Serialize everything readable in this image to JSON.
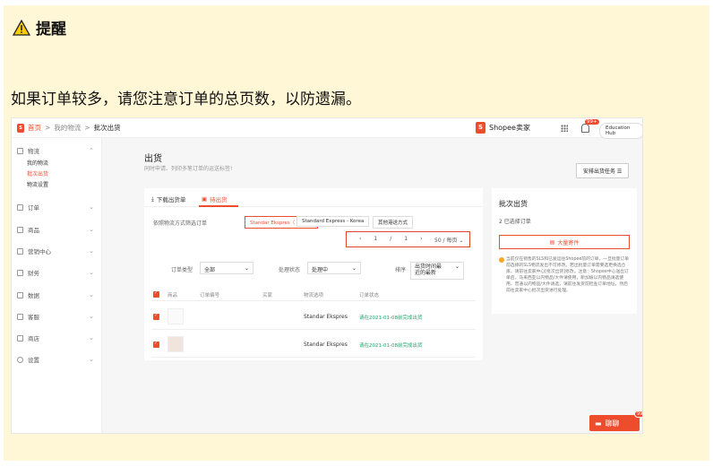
{
  "callout": {
    "title": "提醒",
    "body": "如果订单较多，请您注意订单的总页数，以防遗漏。"
  },
  "breadcrumb": {
    "home": "首页",
    "sep": ">",
    "l2": "我的物流",
    "current": "批次出货"
  },
  "topbar": {
    "brand": "Shopee卖家",
    "brand_icon": "shopee-bag-icon",
    "badge": "99+",
    "edu": "Education Hub"
  },
  "sidebar": {
    "items": [
      {
        "label": "物流",
        "icon": "truck-icon"
      },
      {
        "label": "订单",
        "icon": "clipboard-icon"
      },
      {
        "label": "商品",
        "icon": "box-icon"
      },
      {
        "label": "营销中心",
        "icon": "tag-icon"
      },
      {
        "label": "财务",
        "icon": "wallet-icon"
      },
      {
        "label": "数据",
        "icon": "chart-icon"
      },
      {
        "label": "客服",
        "icon": "chat-icon"
      },
      {
        "label": "商店",
        "icon": "store-icon"
      },
      {
        "label": "设置",
        "icon": "gear-icon"
      }
    ],
    "sub": [
      "我的物流",
      "批次出货",
      "物流设置"
    ]
  },
  "page": {
    "title": "出货",
    "subtitle": "同时申请、列印多笔订单的运送标签!",
    "task_btn": "安排出货任务  ☰"
  },
  "tabs": {
    "download": "下载出货单",
    "pending": "待出货"
  },
  "filter": {
    "label": "依照物流方式筛选订单",
    "chips": [
      "Standar Ekspres（ 156 ）",
      "Standard Express - Korea",
      "其他港送方式"
    ]
  },
  "pager": {
    "prev": "‹",
    "page": "1",
    "sep": "/",
    "total": "1",
    "next": "›",
    "per_page": "50 / 每页"
  },
  "filters2": {
    "order_type_label": "订单类型",
    "order_type_value": "全部",
    "status_label": "处理状态",
    "status_value": "处理中",
    "sort_label": "排序",
    "sort_value": "出货时间最近的最新"
  },
  "table": {
    "headers": [
      "商品",
      "订单编号",
      "买家",
      "物流选项",
      "订单状态"
    ],
    "rows": [
      {
        "shipping": "Standar Ekspres",
        "status": "请在2021-01-08前完成出货"
      },
      {
        "shipping": "Standar Ekspres",
        "status": "请在2021-01-08前完成出货"
      }
    ]
  },
  "right_panel": {
    "title": "批次出货",
    "count": "2 已选择订单",
    "button": "大量寄件",
    "note": "当前仅在销售的SLS和已发运往Shopee前的订单，一旦批量订单前选择的SLS物流发出不可修改。若出批量订单需要选更换选仓库，请前往卖家中心[批次出货]修改。注意：Shopee中心送出订单后，马来西亚以内物品/大件请使用，新加坡以内物品请选使用，普通以内物品/大件请选，请前往发货前检查订单地址，然后前往卖家中心批次出货进行处理。"
  },
  "chat": {
    "label": "聊聊",
    "badge": "99+"
  }
}
